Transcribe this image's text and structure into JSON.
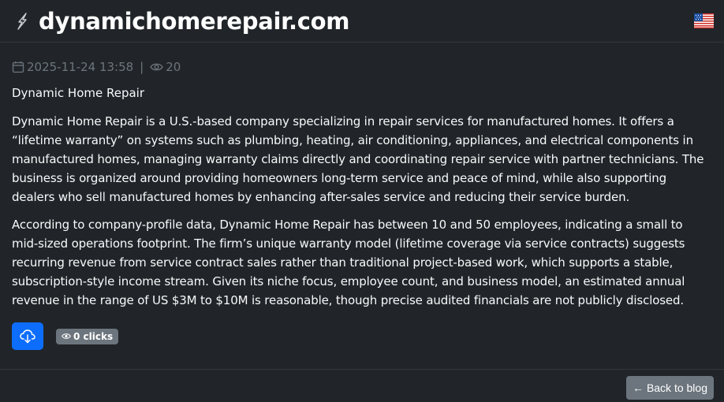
{
  "header": {
    "site_title": "dynamichomerepair.com",
    "logo_icon": "lightning-bolt-icon",
    "flag_icon": "us-flag-icon"
  },
  "meta": {
    "datetime": "2025-11-24 13:58",
    "separator": "|",
    "views": "20"
  },
  "post": {
    "title": "Dynamic Home Repair",
    "paragraphs": [
      "Dynamic Home Repair is a U.S.-based company specializing in repair services for manufactured homes. It offers a “lifetime warranty” on systems such as plumbing, heating, air conditioning, appliances, and electrical components in manufactured homes, managing warranty claims directly and coordinating repair service with partner technicians. The business is organized around providing homeowners long-term service and peace of mind, while also supporting dealers who sell manufactured homes by enhancing after-sales service and reducing their service burden.",
      "According to company-profile data, Dynamic Home Repair has between 10 and 50 employees, indicating a small to mid-sized operations footprint. The firm’s unique warranty model (lifetime coverage via service contracts) suggests recurring revenue from service contract sales rather than traditional project-based work, which supports a stable, subscription-style income stream. Given its niche focus, employee count, and business model, an estimated annual revenue in the range of US $3M to $10M is reasonable, though precise audited financials are not publicly disclosed."
    ]
  },
  "actions": {
    "clicks_label": "0 clicks"
  },
  "footer": {
    "back_label": "Back to blog"
  },
  "colors": {
    "background": "#212529",
    "primary": "#0d6efd",
    "secondary": "#6c757d"
  }
}
